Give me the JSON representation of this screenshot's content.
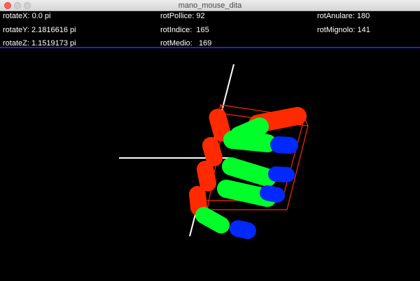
{
  "window": {
    "title": "mano_mouse_dita"
  },
  "stats": {
    "rotate_x": "rotateX: 0.0 pi",
    "rotate_y": "rotateY: 2.1816616 pi",
    "rotate_z": "rotateZ: 1.1519173 pi",
    "rot_pollice": "rotPollice: 92",
    "rot_indice": "rotIndice:  165",
    "rot_medio": "rotMedio:   169",
    "rot_anulare": "rotAnulare: 180",
    "rot_mignolo": "rotMignolo: 141"
  },
  "colors": {
    "background": "#000000",
    "divider": "#1d27c4",
    "segment_base": "#ff2a00",
    "segment_middle": "#00ff2a",
    "segment_tip": "#0028ff",
    "axis": "#ffffff",
    "bounding_box": "#ff2a00"
  }
}
